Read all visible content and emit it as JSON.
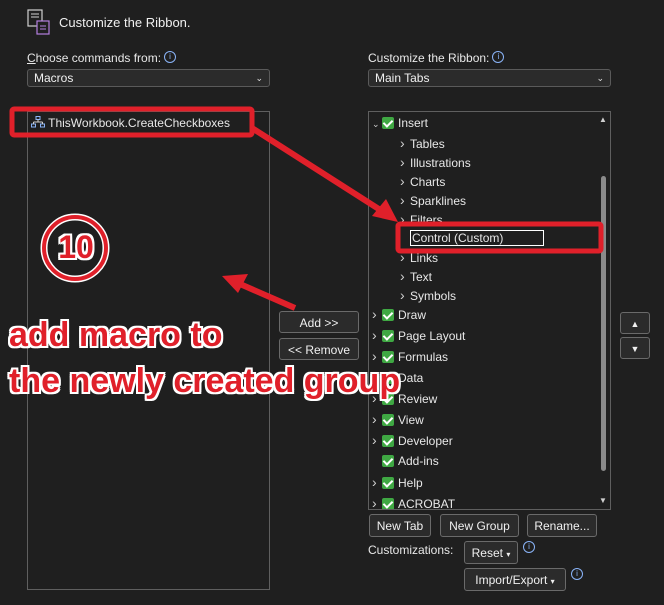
{
  "dialog": {
    "title": "Customize the Ribbon."
  },
  "left": {
    "label_prefix": "C",
    "label_rest": "hoose commands from:",
    "dropdown_value": "Macros",
    "list_items": [
      "ThisWorkbook.CreateCheckboxes"
    ]
  },
  "right": {
    "label": "Customize the Ribbon:",
    "dropdown_value": "Main Tabs",
    "tree": [
      {
        "label": "Insert",
        "level": 0,
        "expander": "down",
        "checkbox": true
      },
      {
        "label": "Tables",
        "level": 1,
        "expander": "right",
        "checkbox": false
      },
      {
        "label": "Illustrations",
        "level": 1,
        "expander": "right",
        "checkbox": false
      },
      {
        "label": "Charts",
        "level": 1,
        "expander": "right",
        "checkbox": false
      },
      {
        "label": "Sparklines",
        "level": 1,
        "expander": "right",
        "checkbox": false
      },
      {
        "label": "Filters",
        "level": 1,
        "expander": "right",
        "checkbox": false
      },
      {
        "label": "Control (Custom)",
        "level": 1,
        "expander": "none",
        "checkbox": false,
        "selected": true
      },
      {
        "label": "Links",
        "level": 1,
        "expander": "right",
        "checkbox": false
      },
      {
        "label": "Text",
        "level": 1,
        "expander": "right",
        "checkbox": false
      },
      {
        "label": "Symbols",
        "level": 1,
        "expander": "right",
        "checkbox": false
      },
      {
        "label": "Draw",
        "level": 0,
        "expander": "right",
        "checkbox": true
      },
      {
        "label": "Page Layout",
        "level": 0,
        "expander": "right",
        "checkbox": true
      },
      {
        "label": "Formulas",
        "level": 0,
        "expander": "right",
        "checkbox": true
      },
      {
        "label": "Data",
        "level": 0,
        "expander": "right",
        "checkbox": true
      },
      {
        "label": "Review",
        "level": 0,
        "expander": "right",
        "checkbox": true
      },
      {
        "label": "View",
        "level": 0,
        "expander": "right",
        "checkbox": true
      },
      {
        "label": "Developer",
        "level": 0,
        "expander": "right",
        "checkbox": true
      },
      {
        "label": "Add-ins",
        "level": 0,
        "expander": "none",
        "checkbox": true
      },
      {
        "label": "Help",
        "level": 0,
        "expander": "right",
        "checkbox": true
      },
      {
        "label": "ACROBAT",
        "level": 0,
        "expander": "right",
        "checkbox": true
      }
    ]
  },
  "buttons": {
    "add": "Add >>",
    "remove": "<< Remove",
    "new_tab": "New Tab",
    "new_group": "New Group",
    "rename": "Rename...",
    "reset": "Reset",
    "import_export": "Import/Export",
    "move_up": "▲",
    "move_down": "▼"
  },
  "customizations_label": "Customizations:",
  "annotation": {
    "step_number": "10",
    "line1": "add macro to",
    "line2": "the newly created group"
  },
  "colors": {
    "annotation_red": "#e0202a",
    "checkbox_green": "#3fa843"
  }
}
